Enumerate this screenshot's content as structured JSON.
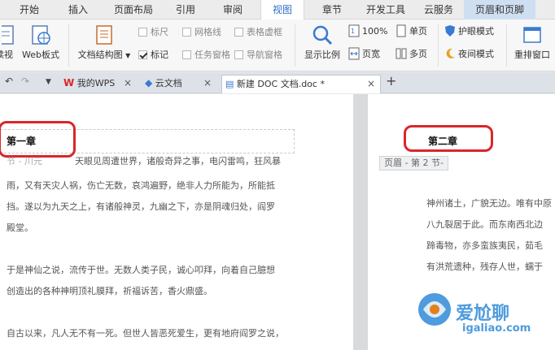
{
  "menu": {
    "tabs": [
      "开始",
      "插入",
      "页面布局",
      "引用",
      "审阅",
      "视图",
      "章节",
      "开发工具",
      "云服务",
      "页眉和页脚"
    ],
    "active": "视图"
  },
  "ribbon": {
    "btn_read": "读视",
    "btn_web": "Web板式",
    "btn_docmap": "文档结构图",
    "cb_ruler": "标尺",
    "cb_gridlines": "网格线",
    "cb_table_borders": "表格虚框",
    "cb_marks": "标记",
    "cb_task_pane": "任务窗格",
    "cb_nav_pane": "导航窗格",
    "btn_zoom": "显示比例",
    "btn_100": "100%",
    "btn_page_width": "页宽",
    "btn_single_page": "单页",
    "btn_multi_page": "多页",
    "btn_eye_mode": "护眼模式",
    "btn_night_mode": "夜间模式",
    "btn_rearrange": "重排窗口"
  },
  "doc_tabs": {
    "tab_wps": "我的WPS",
    "tab_cloud": "云文档",
    "tab_doc": "新建 DOC 文档.doc *",
    "add": "+"
  },
  "page1": {
    "chapter": "第一章",
    "lines": [
      "天眼见周遭世界，诸般奇异之事，电闪雷鸣，狂风暴",
      "雨，又有天灾人祸，伤亡无数，哀鸿遍野，绝非人力所能为，所能抵",
      "挡。遂以为九天之上，有诸般神灵，九幽之下，亦是阴魂归处，阎罗",
      "殿堂。",
      "",
      "于是神仙之说，流传于世。无数人类子民，诚心叩拜，向着自己臆想",
      "创造出的各种神明顶礼膜拜，祈福诉苦，香火鼎盛。",
      "",
      "自古以来，凡人无不有一死。但世人皆恶死爱生，更有地府阎罗之说，"
    ],
    "partial_prefix": "节 - 川元"
  },
  "page2": {
    "chapter": "第二章",
    "footer_tag": "页眉 - 第 2 节-",
    "lines": [
      "神州诸土，广貌无边。唯有中原",
      "八九裂居于此。而东南西北边",
      "蹄毒物，亦多蛮族夷民，茹毛",
      "有洪荒遗种，残存人世，蠕于"
    ]
  },
  "watermark": {
    "site_cn": "爱尬聊",
    "site_url": "igaliao.com"
  },
  "colors": {
    "accent_blue": "#2d6fc7",
    "highlight_red": "#d9262b",
    "context_tab": "#cfdff2"
  }
}
